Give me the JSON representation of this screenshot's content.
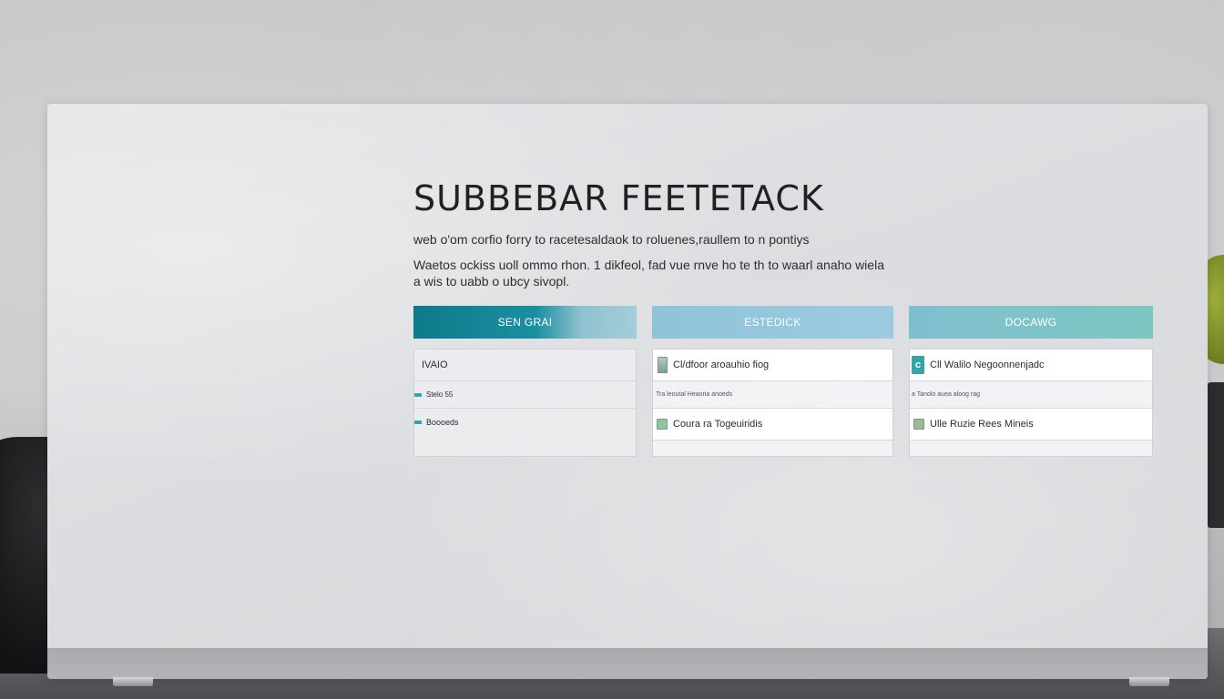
{
  "header": {
    "title": "SUBBEBAR FEETETACK",
    "subtitle": "web o'om corfio forry to racetesaldaok to roluenes,raullem to n pontiys",
    "description": "Waetos ockiss uoll ommo rhon.  1 dikfeol, fad vue rnve ho te th to waarl anaho wiela a wis to uabb o ubcy sivopl."
  },
  "columns": [
    {
      "header": "SEN GRAI",
      "rows": [
        {
          "label": "IVAIO"
        },
        {
          "label": "Stelo 55"
        },
        {
          "label": "Boooeds"
        }
      ]
    },
    {
      "header": "ESTEDICK",
      "rows": [
        {
          "label": "Cl/dfoor aroauhio fiog"
        },
        {
          "label": "Tra leoutal Heaoria anoeds"
        },
        {
          "label": "Coura ra Togeuiridis"
        }
      ]
    },
    {
      "header": "DOCAWG",
      "rows": [
        {
          "label": "Cll Walilo Negoonnenjadc"
        },
        {
          "label": "a Tanolo auea aloog rag"
        },
        {
          "label": "Ulle Ruzie Rees Mineis"
        }
      ]
    }
  ],
  "colors": {
    "accent_teal": "#0e7a8a",
    "header_light_blue": "#9ccbe0",
    "header_mint": "#7ec6c2",
    "panel_bg": "#dcdde0"
  }
}
